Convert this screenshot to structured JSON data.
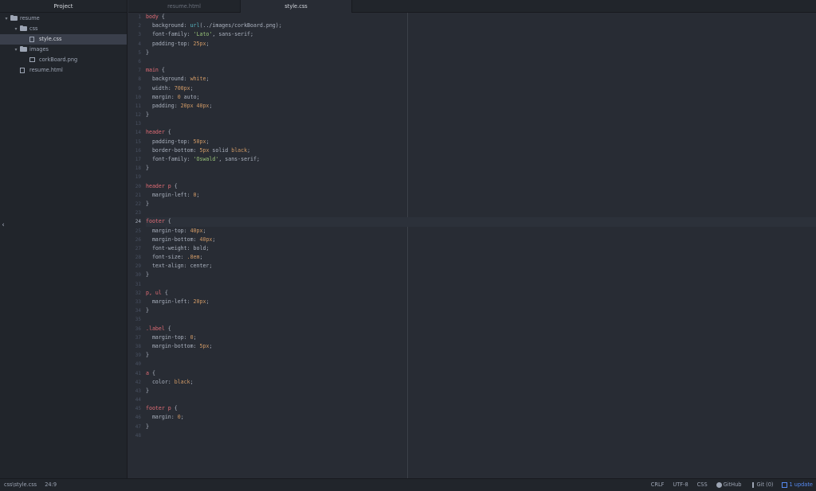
{
  "sidebar": {
    "title": "Project",
    "tree": [
      {
        "label": "resume",
        "type": "folder",
        "depth": 0,
        "expanded": true
      },
      {
        "label": "css",
        "type": "folder",
        "depth": 1,
        "expanded": true
      },
      {
        "label": "style.css",
        "type": "file",
        "depth": 2,
        "selected": true
      },
      {
        "label": "images",
        "type": "folder",
        "depth": 1,
        "expanded": true
      },
      {
        "label": "corkBoard.png",
        "type": "image",
        "depth": 2
      },
      {
        "label": "resume.html",
        "type": "file",
        "depth": 1
      }
    ]
  },
  "tabs": [
    {
      "label": "resume.html",
      "active": false
    },
    {
      "label": "style.css",
      "active": true
    }
  ],
  "editor": {
    "cursor_line": 24,
    "lines": [
      [
        [
          "t-sel",
          "body"
        ],
        [
          "t-punc",
          " {"
        ]
      ],
      [
        [
          "t-prop",
          "  background: "
        ],
        [
          "t-fn",
          "url"
        ],
        [
          "t-punc",
          "(../images/corkBoard.png);"
        ]
      ],
      [
        [
          "t-prop",
          "  font-family: "
        ],
        [
          "t-str",
          "'Lato'"
        ],
        [
          "t-punc",
          ", sans-serif;"
        ]
      ],
      [
        [
          "t-prop",
          "  padding-top: "
        ],
        [
          "t-num",
          "25px"
        ],
        [
          "t-punc",
          ";"
        ]
      ],
      [
        [
          "t-punc",
          "}"
        ]
      ],
      [],
      [
        [
          "t-sel",
          "main"
        ],
        [
          "t-punc",
          " {"
        ]
      ],
      [
        [
          "t-prop",
          "  background: "
        ],
        [
          "t-num",
          "white"
        ],
        [
          "t-punc",
          ";"
        ]
      ],
      [
        [
          "t-prop",
          "  width: "
        ],
        [
          "t-num",
          "700px"
        ],
        [
          "t-punc",
          ";"
        ]
      ],
      [
        [
          "t-prop",
          "  margin: "
        ],
        [
          "t-num",
          "0"
        ],
        [
          "t-punc",
          " auto;"
        ]
      ],
      [
        [
          "t-prop",
          "  padding: "
        ],
        [
          "t-num",
          "20px 40px"
        ],
        [
          "t-punc",
          ";"
        ]
      ],
      [
        [
          "t-punc",
          "}"
        ]
      ],
      [],
      [
        [
          "t-sel",
          "header"
        ],
        [
          "t-punc",
          " {"
        ]
      ],
      [
        [
          "t-prop",
          "  padding-top: "
        ],
        [
          "t-num",
          "50px"
        ],
        [
          "t-punc",
          ";"
        ]
      ],
      [
        [
          "t-prop",
          "  border-bottom: "
        ],
        [
          "t-num",
          "5px"
        ],
        [
          "t-punc",
          " solid "
        ],
        [
          "t-num",
          "black"
        ],
        [
          "t-punc",
          ";"
        ]
      ],
      [
        [
          "t-prop",
          "  font-family: "
        ],
        [
          "t-str",
          "'Oswald'"
        ],
        [
          "t-punc",
          ", sans-serif;"
        ]
      ],
      [
        [
          "t-punc",
          "}"
        ]
      ],
      [],
      [
        [
          "t-sel",
          "header p"
        ],
        [
          "t-punc",
          " {"
        ]
      ],
      [
        [
          "t-prop",
          "  margin-left: "
        ],
        [
          "t-num",
          "0"
        ],
        [
          "t-punc",
          ";"
        ]
      ],
      [
        [
          "t-punc",
          "}"
        ]
      ],
      [],
      [
        [
          "t-sel",
          "footer"
        ],
        [
          "t-punc",
          " {"
        ]
      ],
      [
        [
          "t-prop",
          "  margin-top: "
        ],
        [
          "t-num",
          "40px"
        ],
        [
          "t-punc",
          ";"
        ]
      ],
      [
        [
          "t-prop",
          "  margin-bottom: "
        ],
        [
          "t-num",
          "40px"
        ],
        [
          "t-punc",
          ";"
        ]
      ],
      [
        [
          "t-prop",
          "  font-weight: bold;"
        ]
      ],
      [
        [
          "t-prop",
          "  font-size: "
        ],
        [
          "t-num",
          ".8em"
        ],
        [
          "t-punc",
          ";"
        ]
      ],
      [
        [
          "t-prop",
          "  text-align: center;"
        ]
      ],
      [
        [
          "t-punc",
          "}"
        ]
      ],
      [],
      [
        [
          "t-sel",
          "p, ul"
        ],
        [
          "t-punc",
          " {"
        ]
      ],
      [
        [
          "t-prop",
          "  margin-left: "
        ],
        [
          "t-num",
          "20px"
        ],
        [
          "t-punc",
          ";"
        ]
      ],
      [
        [
          "t-punc",
          "}"
        ]
      ],
      [],
      [
        [
          "t-sel",
          ".label"
        ],
        [
          "t-punc",
          " {"
        ]
      ],
      [
        [
          "t-prop",
          "  margin-top: "
        ],
        [
          "t-num",
          "0"
        ],
        [
          "t-punc",
          ";"
        ]
      ],
      [
        [
          "t-prop",
          "  margin-bottom: "
        ],
        [
          "t-num",
          "5px"
        ],
        [
          "t-punc",
          ";"
        ]
      ],
      [
        [
          "t-punc",
          "}"
        ]
      ],
      [],
      [
        [
          "t-sel",
          "a"
        ],
        [
          "t-punc",
          " {"
        ]
      ],
      [
        [
          "t-prop",
          "  color: "
        ],
        [
          "t-num",
          "black"
        ],
        [
          "t-punc",
          ";"
        ]
      ],
      [
        [
          "t-punc",
          "}"
        ]
      ],
      [],
      [
        [
          "t-sel",
          "footer p"
        ],
        [
          "t-punc",
          " {"
        ]
      ],
      [
        [
          "t-prop",
          "  margin: "
        ],
        [
          "t-num",
          "0"
        ],
        [
          "t-punc",
          ";"
        ]
      ],
      [
        [
          "t-punc",
          "}"
        ]
      ],
      []
    ]
  },
  "statusbar": {
    "file_path": "css\\style.css",
    "cursor_position": "24:9",
    "line_ending": "CRLF",
    "encoding": "UTF-8",
    "grammar": "CSS",
    "github": "GitHub",
    "git": "Git (0)",
    "update": "1 update"
  }
}
